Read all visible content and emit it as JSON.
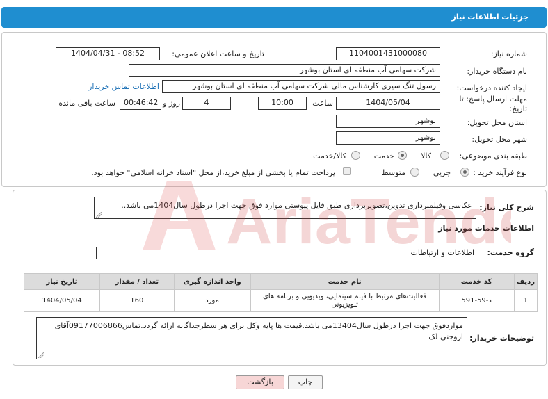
{
  "header": {
    "title": "جزئیات اطلاعات نیاز"
  },
  "fields": {
    "need_number_label": "شماره نیاز:",
    "need_number": "1104001431000080",
    "announce_label": "تاریخ و ساعت اعلان عمومی:",
    "announce_value": "1404/04/31 - 08:52",
    "buyer_label": "نام دستگاه خریدار:",
    "buyer_value": "شرکت سهامی آب منطقه ای استان بوشهر",
    "creator_label": "ایجاد کننده درخواست:",
    "creator_value": "رسول تنگ سیری کارشناس مالی شرکت سهامی آب منطقه ای استان بوشهر",
    "buyer_contact_link": "اطلاعات تماس خریدار",
    "deadline_label": "مهلت ارسال پاسخ: تا تاریخ:",
    "deadline_date": "1404/05/04",
    "time_label": "ساعت",
    "deadline_time": "10:00",
    "days_value": "4",
    "days_label": "روز و",
    "remaining_time": "00:46:42",
    "remaining_label": "ساعت باقی مانده",
    "province_label": "استان محل تحویل:",
    "province_value": "بوشهر",
    "city_label": "شهر محل تحویل:",
    "city_value": "بوشهر",
    "category_label": "طبقه بندی موضوعی:",
    "category_options": [
      "کالا",
      "خدمت",
      "کالا/خدمت"
    ],
    "category_selected": "خدمت",
    "process_label": "نوع فرآیند خرید :",
    "process_options": [
      "جزیی",
      "متوسط"
    ],
    "process_selected": "جزیی",
    "payment_note": "پرداخت تمام یا بخشی از مبلغ خرید،از محل \"اسناد خزانه اسلامی\" خواهد بود."
  },
  "general": {
    "desc_label": "شرح کلی نیاز:",
    "desc_value": "عکاسی وفیلمبرداری تدوین،تصویربرداری طبق فایل پیوستی موارد فوق جهت اجرا درطول سال1404می باشد..",
    "services_heading": "اطلاعات خدمات مورد نیاز",
    "group_label": "گروه خدمت:",
    "group_value": "اطلاعات و ارتباطات"
  },
  "table": {
    "headers": [
      "ردیف",
      "کد خدمت",
      "نام خدمت",
      "واحد اندازه گیری",
      "تعداد / مقدار",
      "تاریخ نیاز"
    ],
    "rows": [
      [
        "1",
        "د-59-591",
        "فعالیت‌های مرتبط با فیلم سینمایی، ویدیویی و برنامه های تلویزیونی",
        "مورد",
        "160",
        "1404/05/04"
      ]
    ]
  },
  "buyer_notes": {
    "label": "توضیحات خریدار:",
    "value": "مواردفوق جهت اجرا درطول سال13404می باشد.قیمت ها پایه وکل برای هر سطرجداگانه ارائه گردد.تماس09177006866آقای اروجنی لک"
  },
  "buttons": {
    "print": "چاپ",
    "back": "بازگشت"
  },
  "watermark": {
    "text": "AriaTender.neT"
  },
  "colors": {
    "header_bg": "#1f8ed0",
    "link": "#1a6fb5",
    "back_button_bg": "#f7d6d6"
  }
}
